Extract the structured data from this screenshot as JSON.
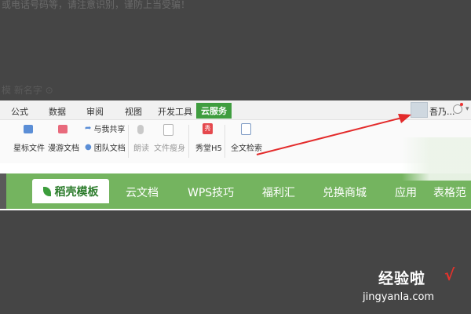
{
  "background_text": {
    "top": "或电话号码等，请注意识别，谨防上当受骗！",
    "middle": "模    新名字    ⊙"
  },
  "ribbon_tabs": [
    "公式",
    "数据",
    "审阅",
    "视图",
    "开发工具",
    "云服务"
  ],
  "active_tab": "云服务",
  "user": {
    "name": "吾乃..."
  },
  "toolbar": {
    "star_files": "星标文件",
    "roam_docs": "漫游文档",
    "shared_with_me": "与我共享",
    "team_docs": "团队文档",
    "read_aloud": "朗读",
    "file_slim": "文件瘦身",
    "xiutang_h5": "秀堂H5",
    "fulltext_search": "全文检索"
  },
  "green_tabs": {
    "active": "稻壳模板",
    "items": [
      "云文档",
      "WPS技巧",
      "福利汇",
      "兑换商城",
      "应用",
      "表格范"
    ]
  },
  "watermark": {
    "cn": "经验啦",
    "check": "√",
    "en": "jingyanla.com"
  },
  "colors": {
    "accent_green": "#3f9d3f",
    "banner_green": "#74b45f",
    "arrow_red": "#e32b2b",
    "page_dark": "#454545"
  }
}
